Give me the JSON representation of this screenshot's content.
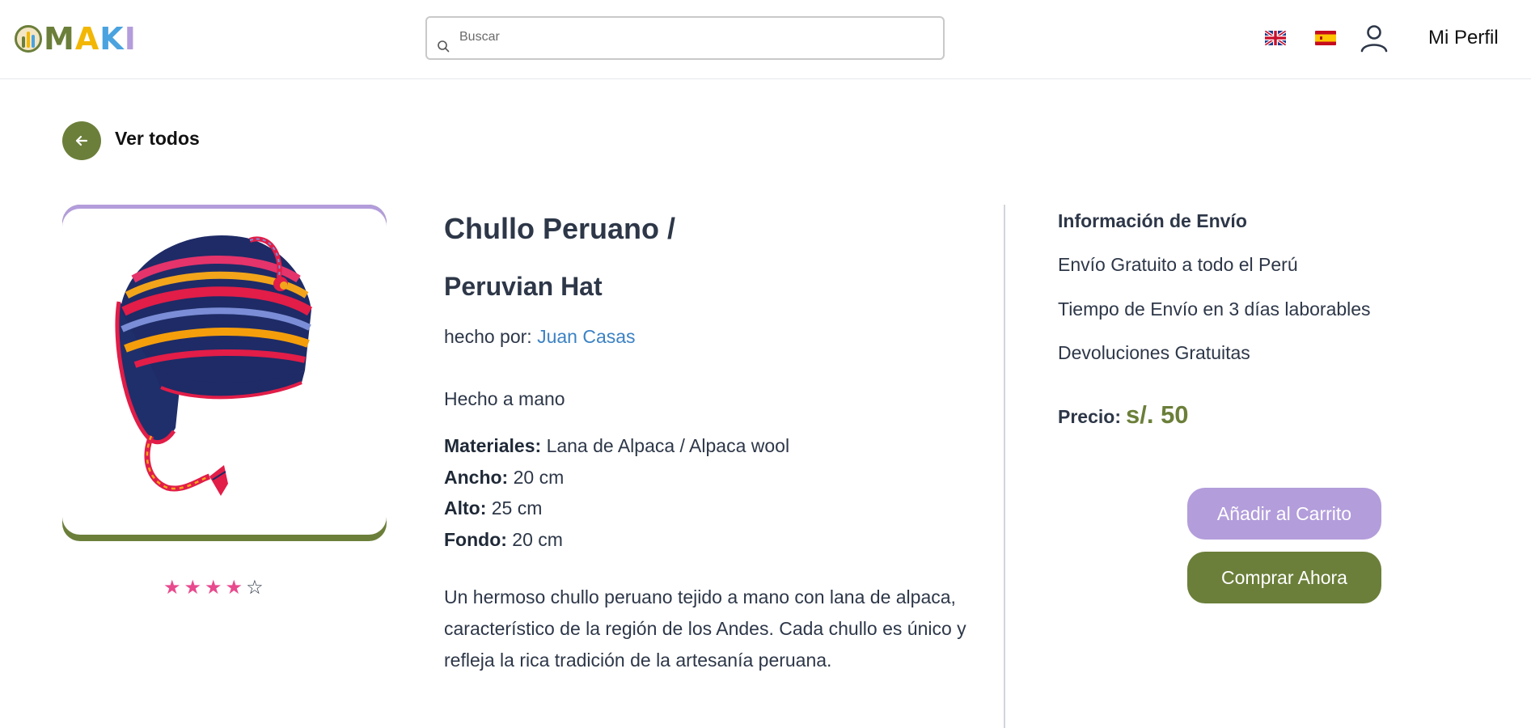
{
  "brand": {
    "logo_text": "MAKI",
    "colors": {
      "olive": "#6b7f3a",
      "lavender": "#b39ddb",
      "pink_star": "#e84a8e",
      "link_blue": "#3b82c4"
    }
  },
  "header": {
    "search": {
      "placeholder": "Buscar",
      "value": ""
    },
    "language_flags": [
      {
        "icon": "uk-flag-icon"
      },
      {
        "icon": "spain-flag-icon"
      }
    ],
    "user_icon": "user-icon",
    "profile_label": "Mi Perfil"
  },
  "back": {
    "label": "Ver todos",
    "icon": "arrow-left-icon"
  },
  "product": {
    "title_line1": "Chullo Peruano /",
    "title_line2": "Peruvian Hat",
    "maker_prefix": "hecho por:",
    "maker_name": "Juan Casas",
    "handmade": "Hecho a mano",
    "specs": [
      {
        "label": "Materiales:",
        "value": "Lana de Alpaca / Alpaca wool"
      },
      {
        "label": "Ancho:",
        "value": "20 cm"
      },
      {
        "label": "Alto:",
        "value": "25 cm"
      },
      {
        "label": "Fondo:",
        "value": "20 cm"
      }
    ],
    "description": "Un hermoso chullo peruano tejido a mano con lana de alpaca, característico de la región de los Andes. Cada chullo es único y refleja la rica tradición de la artesanía peruana.",
    "rating": {
      "value": 4,
      "max": 5
    }
  },
  "shipping": {
    "title": "Información de Envío",
    "items": [
      "Envío Gratuito a todo el Perú",
      "Tiempo de Envío en 3 días laborables",
      "Devoluciones Gratuitas"
    ]
  },
  "price": {
    "label": "Precio:",
    "value": "s/. 50"
  },
  "actions": {
    "add_to_cart": "Añadir al Carrito",
    "buy_now": "Comprar Ahora"
  }
}
